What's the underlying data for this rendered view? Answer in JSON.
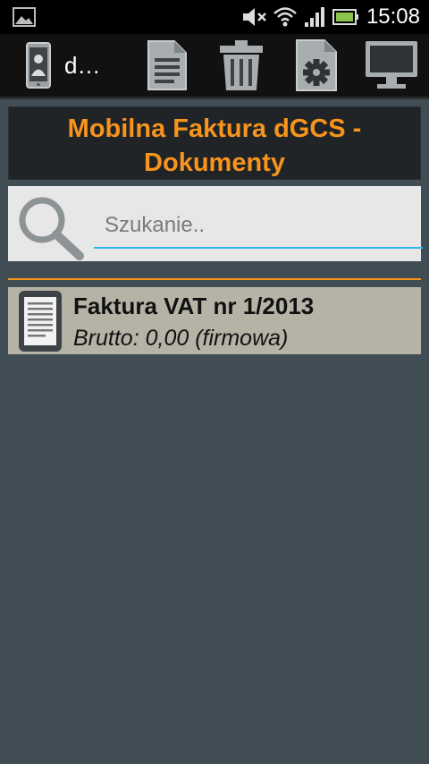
{
  "status_bar": {
    "time": "15:08",
    "icons": [
      "gallery-icon",
      "mute-icon",
      "wifi-icon",
      "signal-icon",
      "battery-icon"
    ]
  },
  "action_bar": {
    "title": "d…",
    "buttons": [
      "contact-icon",
      "document-icon",
      "trash-icon",
      "settings-document-icon",
      "monitor-icon"
    ]
  },
  "header": {
    "title_line1": "Mobilna Faktura dGCS -",
    "title_line2": "Dokumenty"
  },
  "search": {
    "placeholder": "Szukanie.."
  },
  "documents": [
    {
      "title": "Faktura VAT nr 1/2013",
      "subtitle": "Brutto: 0,00 (firmowa)"
    }
  ],
  "colors": {
    "accent": "#f7941d",
    "background": "#414d54",
    "input_underline": "#33b5e5",
    "list_item_bg": "#b5b3a6"
  }
}
